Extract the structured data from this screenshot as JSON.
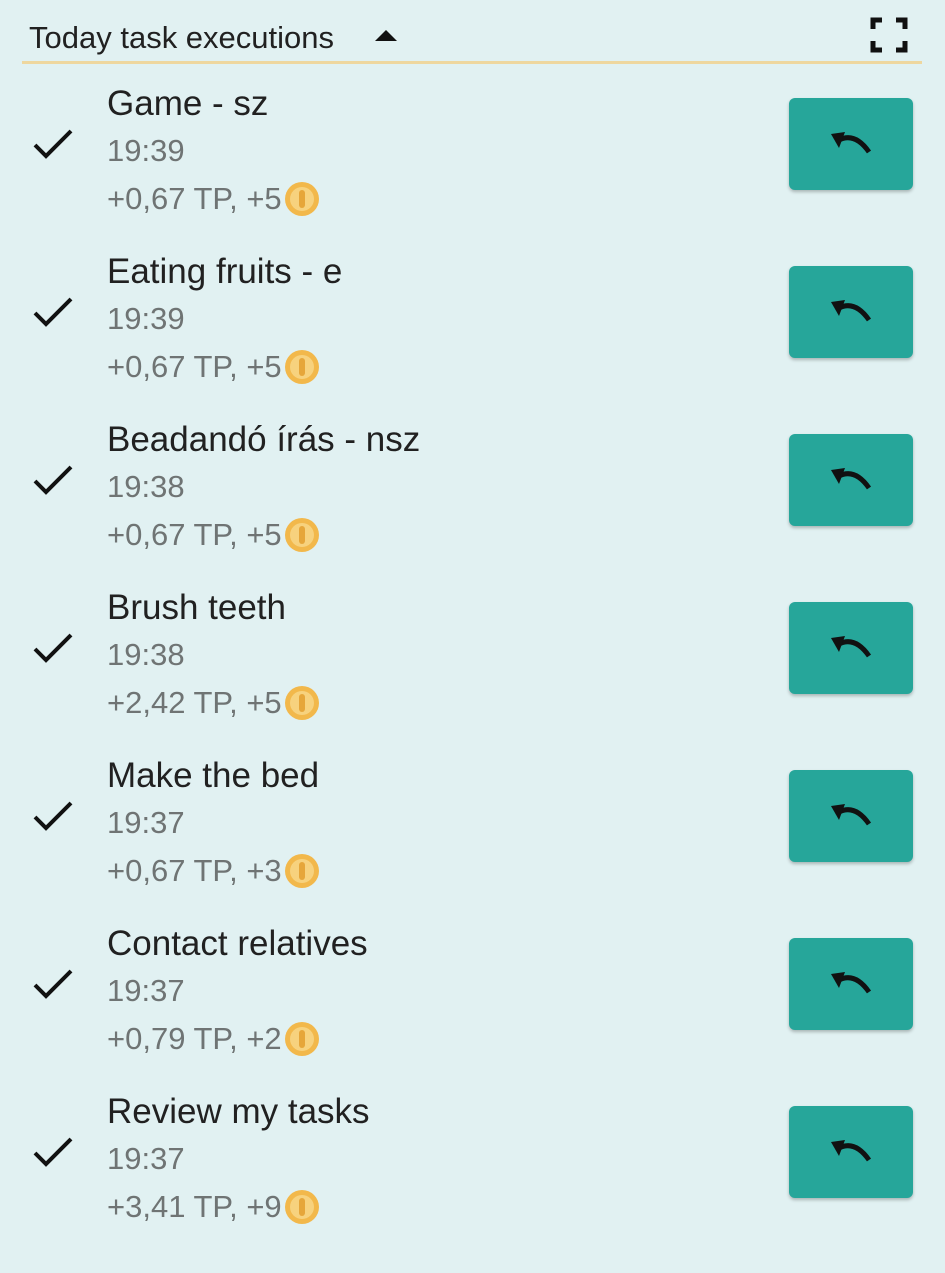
{
  "header": {
    "title": "Today task executions",
    "toggle_icon": "caret-up-icon",
    "fullscreen_icon": "fullscreen-icon"
  },
  "colors": {
    "background": "#e1f1f2",
    "accent_button": "#26a69a",
    "divider": "#eed79f",
    "coin": "#f2b84b",
    "secondary_text": "#6f7474"
  },
  "tasks": [
    {
      "name": "Game - sz",
      "time": "19:39",
      "reward": "+0,67 TP, +5"
    },
    {
      "name": "Eating fruits - e",
      "time": "19:39",
      "reward": "+0,67 TP, +5"
    },
    {
      "name": "Beadandó írás - nsz",
      "time": "19:38",
      "reward": "+0,67 TP, +5"
    },
    {
      "name": "Brush teeth",
      "time": "19:38",
      "reward": "+2,42 TP, +5"
    },
    {
      "name": "Make the bed",
      "time": "19:37",
      "reward": "+0,67 TP, +3"
    },
    {
      "name": "Contact relatives",
      "time": "19:37",
      "reward": "+0,79 TP, +2"
    },
    {
      "name": "Review my tasks",
      "time": "19:37",
      "reward": "+3,41 TP, +9"
    }
  ]
}
